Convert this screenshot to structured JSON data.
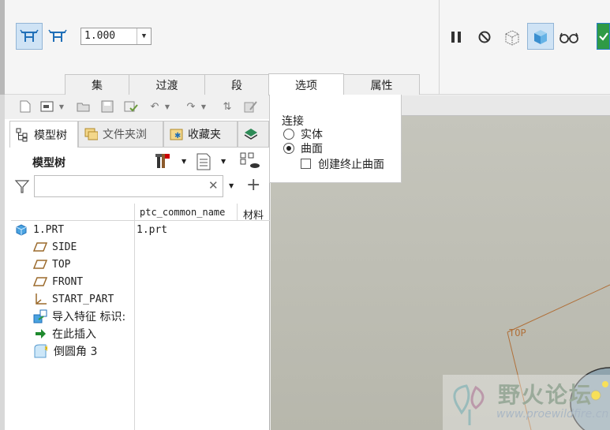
{
  "ribbon": {
    "depth_value": "1.000",
    "tabs": [
      {
        "label": "集"
      },
      {
        "label": "过渡"
      },
      {
        "label": "段"
      },
      {
        "label": "选项"
      },
      {
        "label": "属性"
      }
    ],
    "icons": [
      "pattern-icon-1",
      "pattern-icon-2",
      "pause-icon",
      "cancel-icon",
      "preview-wireframe-icon",
      "preview-solid-icon",
      "glasses-icon",
      "ok-icon"
    ]
  },
  "options_panel": {
    "section_label": "连接",
    "radio_solid": "实体",
    "radio_surface": "曲面",
    "selected": "曲面",
    "checkbox_label": "创建终止曲面",
    "checkbox_checked": false
  },
  "panel_tabs": [
    {
      "label": "模型树"
    },
    {
      "label": "文件夹浏"
    },
    {
      "label": "收藏夹"
    }
  ],
  "model_tree": {
    "title": "模型树",
    "search_placeholder": "",
    "columns": [
      "ptc_common_name",
      "材料"
    ],
    "rows": [
      {
        "label": "1.PRT",
        "col1": "1.prt",
        "icon": "part-icon"
      },
      {
        "label": "SIDE",
        "col1": "",
        "icon": "datum-plane-icon"
      },
      {
        "label": "TOP",
        "col1": "",
        "icon": "datum-plane-icon"
      },
      {
        "label": "FRONT",
        "col1": "",
        "icon": "datum-plane-icon"
      },
      {
        "label": "START_PART",
        "col1": "",
        "icon": "coord-system-icon"
      },
      {
        "label": "导入特征 标识:",
        "col1": "",
        "icon": "import-feature-icon"
      },
      {
        "label": "在此插入",
        "col1": "",
        "icon": "insert-here-arrow-icon"
      },
      {
        "label": "倒圆角 3",
        "col1": "",
        "icon": "round-feature-icon"
      }
    ]
  },
  "graphics": {
    "datum_label": "TOP",
    "watermark_title": "野火论坛",
    "watermark_url": "www.proewildfire.cn"
  },
  "colors": {
    "accent_blue": "#1f88d6",
    "tab_active": "#ffffff",
    "graphics_bg": "#bfbfb5",
    "datum_line": "#b0703a"
  }
}
